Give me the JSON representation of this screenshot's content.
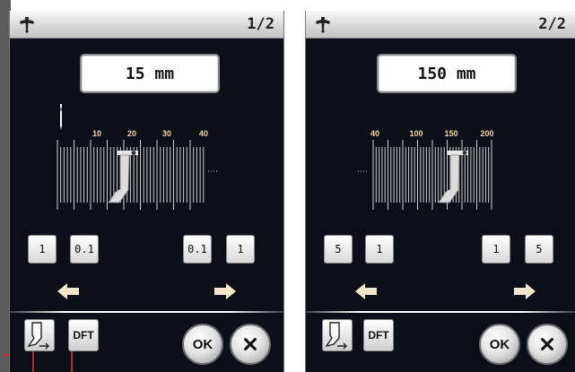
{
  "screens": [
    {
      "page_indicator": "1/2",
      "value": "15 mm",
      "scale_labels": [
        "10",
        "20",
        "30",
        "40"
      ],
      "left_steppers": [
        "1",
        "0.1"
      ],
      "right_steppers": [
        "0.1",
        "1"
      ],
      "foot_button": {
        "icon": "presser-foot-icon"
      },
      "default_button": "DFT",
      "ok_button": "OK",
      "close_button": {
        "icon": "close-icon"
      }
    },
    {
      "page_indicator": "2/2",
      "value": "150 mm",
      "scale_labels": [
        "40",
        "100",
        "150",
        "200"
      ],
      "left_steppers": [
        "5",
        "1"
      ],
      "right_steppers": [
        "1",
        "5"
      ],
      "foot_button": {
        "icon": "presser-foot-icon"
      },
      "default_button": "DFT",
      "ok_button": "OK",
      "close_button": {
        "icon": "close-icon"
      }
    }
  ],
  "colors": {
    "panel_bg": "#0c0f18",
    "scale_label": "#f2d7a8",
    "arrow": "#f4e6c8",
    "callout": "#c0272d"
  },
  "icons": {
    "logo": "needle-logo-icon",
    "left_arrow": "arrow-left-icon",
    "right_arrow": "arrow-right-icon"
  }
}
